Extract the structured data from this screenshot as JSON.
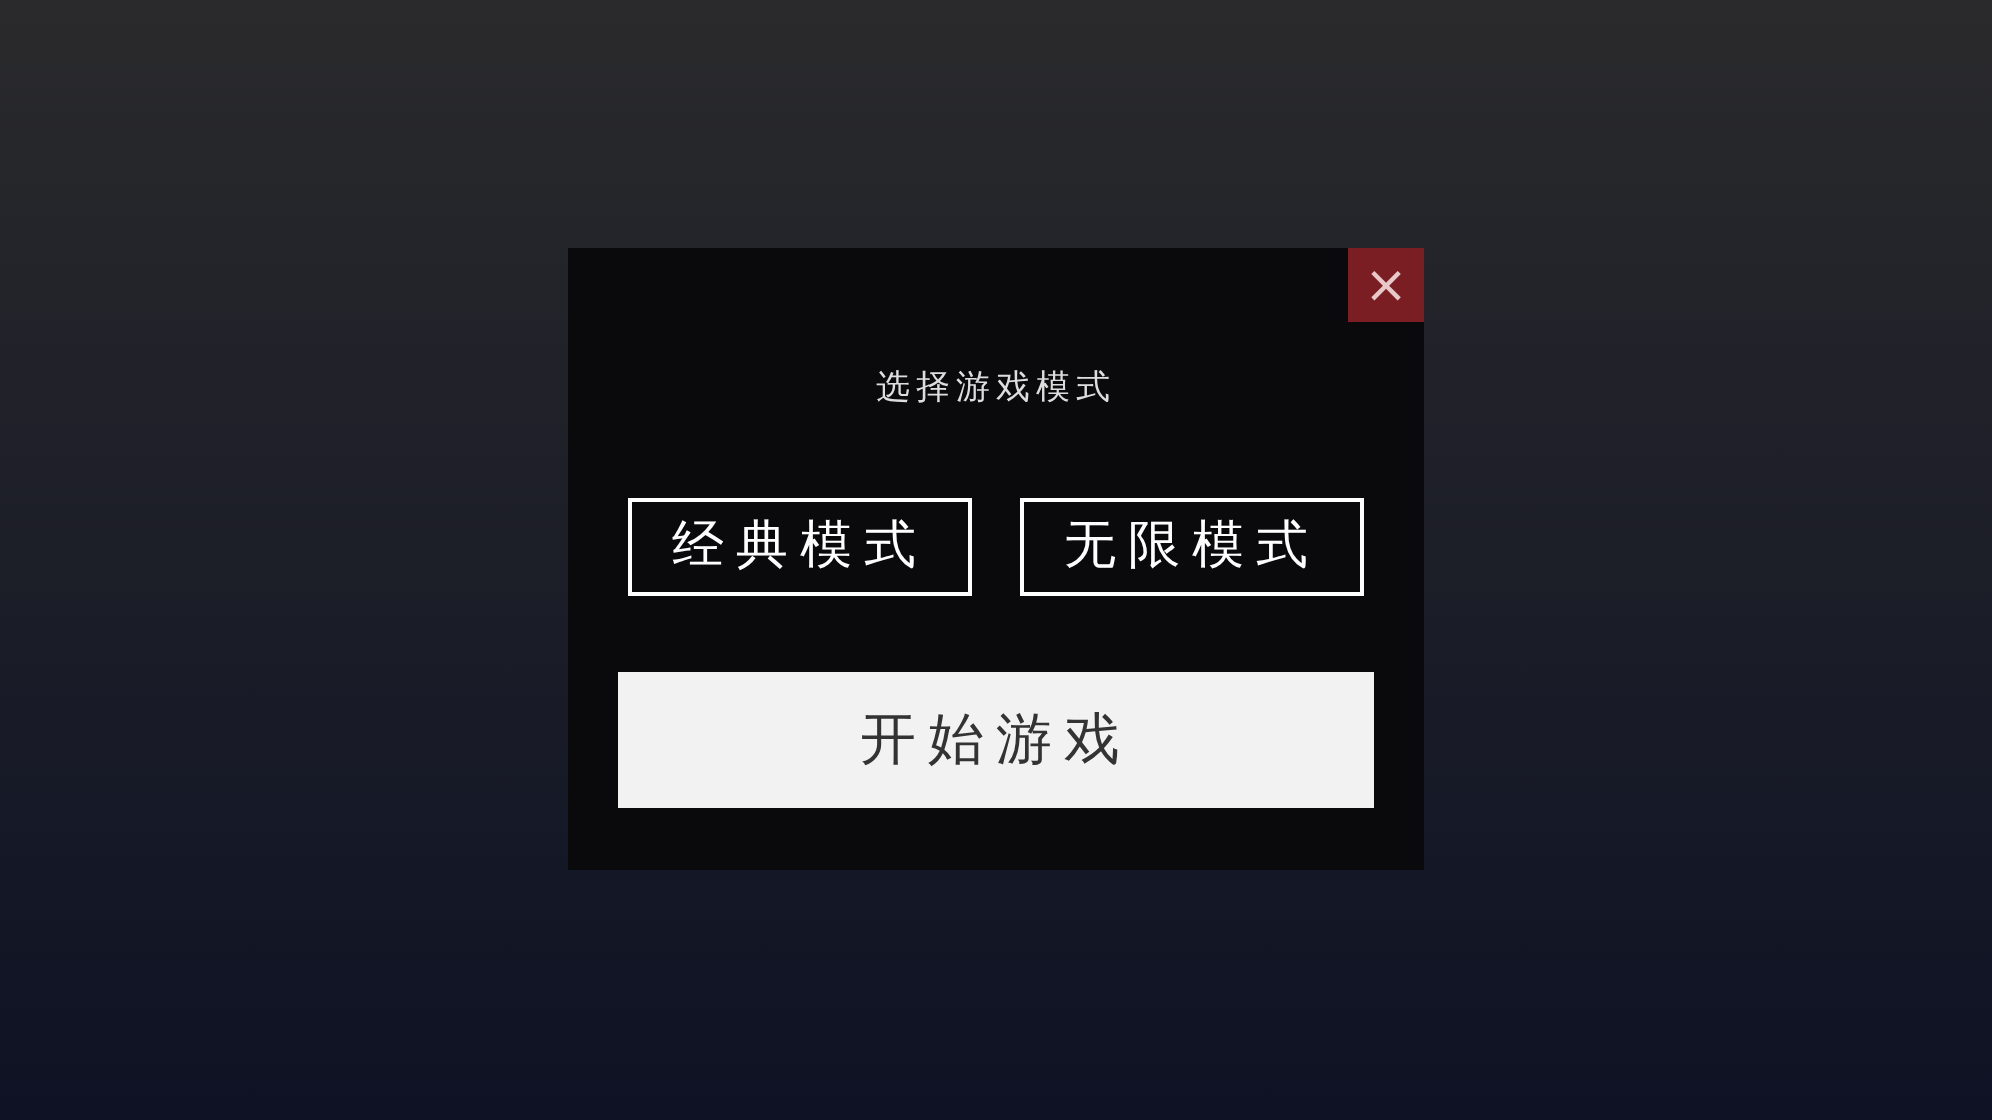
{
  "dialog": {
    "title": "选择游戏模式",
    "close": "×",
    "modes": [
      {
        "label": "经典模式"
      },
      {
        "label": "无限模式"
      }
    ],
    "start_button": "开始游戏"
  }
}
